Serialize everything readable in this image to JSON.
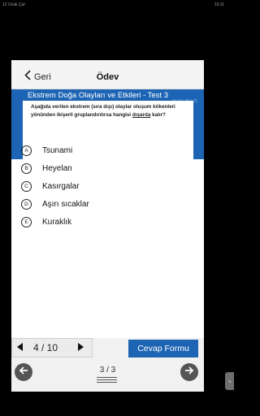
{
  "status_bar": {
    "left_text": "12 Ocak Çar",
    "right_text": "10:11"
  },
  "top_bar": {
    "back_label": "Geri",
    "title": "Ödev"
  },
  "test": {
    "title": "Ekstrem Doğa Olayları ve Etkileri - Test 3",
    "subtitle": "10 10 / 05 / 21"
  },
  "question": {
    "text_before": "Aşağıda verilen ekstrem (sıra dışı) olaylar oluşum kökenleri yönünden ikişerli gruplandırılırsa hangisi ",
    "text_emphasis": "dışarda",
    "text_after": " kalır?"
  },
  "options": [
    {
      "letter": "A",
      "text": "Tsunami"
    },
    {
      "letter": "B",
      "text": "Heyelan"
    },
    {
      "letter": "C",
      "text": "Kasırgalar"
    },
    {
      "letter": "D",
      "text": "Aşırı sıcaklar"
    },
    {
      "letter": "E",
      "text": "Kuraklık"
    }
  ],
  "pager": {
    "text": "4  / 10",
    "current": 4,
    "total": 10
  },
  "form_button_label": "Cevap Formu",
  "page_count": "3 / 3",
  "icons": {
    "back": "chevron-left-icon",
    "prev": "triangle-left-icon",
    "next": "triangle-right-icon",
    "nav_prev": "arrow-left-icon",
    "nav_next": "arrow-right-icon"
  },
  "colors": {
    "accent": "#1d65b4",
    "background": "#000000"
  }
}
